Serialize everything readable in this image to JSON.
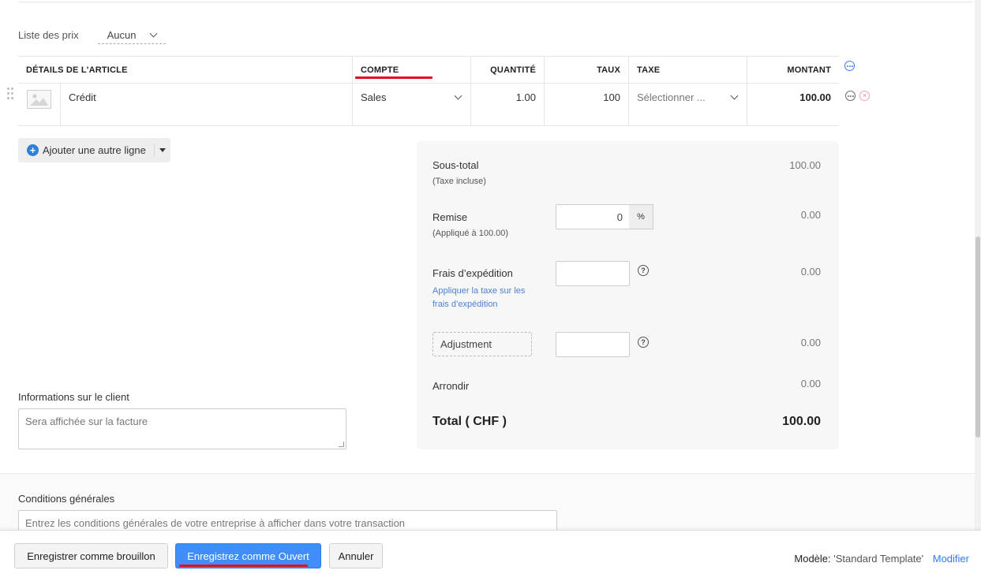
{
  "price_list": {
    "label": "Liste des prix",
    "value": "Aucun"
  },
  "table": {
    "headers": {
      "item": "DÉTAILS DE L'ARTICLE",
      "account": "COMPTE",
      "quantity": "QUANTITÉ",
      "rate": "TAUX",
      "tax": "TAXE",
      "amount": "MONTANT"
    },
    "rows": [
      {
        "item": "Crédit",
        "account": "Sales",
        "quantity": "1.00",
        "rate": "100",
        "tax": "Sélectionner ...",
        "amount": "100.00"
      }
    ]
  },
  "add_line": {
    "label": "Ajouter une autre ligne"
  },
  "totals": {
    "subtotal_label": "Sous-total",
    "subtotal_note": "(Taxe incluse)",
    "subtotal_value": "100.00",
    "discount_label": "Remise",
    "discount_note": "(Appliqué à 100.00)",
    "discount_input": "0",
    "discount_unit": "%",
    "discount_value": "0.00",
    "shipping_label": "Frais d’expédition",
    "shipping_link": "Appliquer la taxe sur les frais d’expédition",
    "shipping_value": "0.00",
    "adjustment_label": "Adjustment",
    "adjustment_value": "0.00",
    "rounding_label": "Arrondir",
    "rounding_value": "0.00",
    "total_label": "Total ( CHF )",
    "total_value": "100.00"
  },
  "customer_info": {
    "label": "Informations sur le client",
    "placeholder": "Sera affichée sur la facture"
  },
  "terms": {
    "label": "Conditions générales",
    "placeholder": "Entrez les conditions générales de votre entreprise à afficher dans votre transaction"
  },
  "footer": {
    "save_draft": "Enregistrer comme brouillon",
    "save_open": "Enregistrez comme Ouvert",
    "cancel": "Annuler",
    "template_label": "Modèle:",
    "template_name": "'Standard Template'",
    "modify": "Modifier"
  },
  "colors": {
    "accent": "#408dfb",
    "highlight": "#e01020",
    "link": "#2f7be8"
  }
}
